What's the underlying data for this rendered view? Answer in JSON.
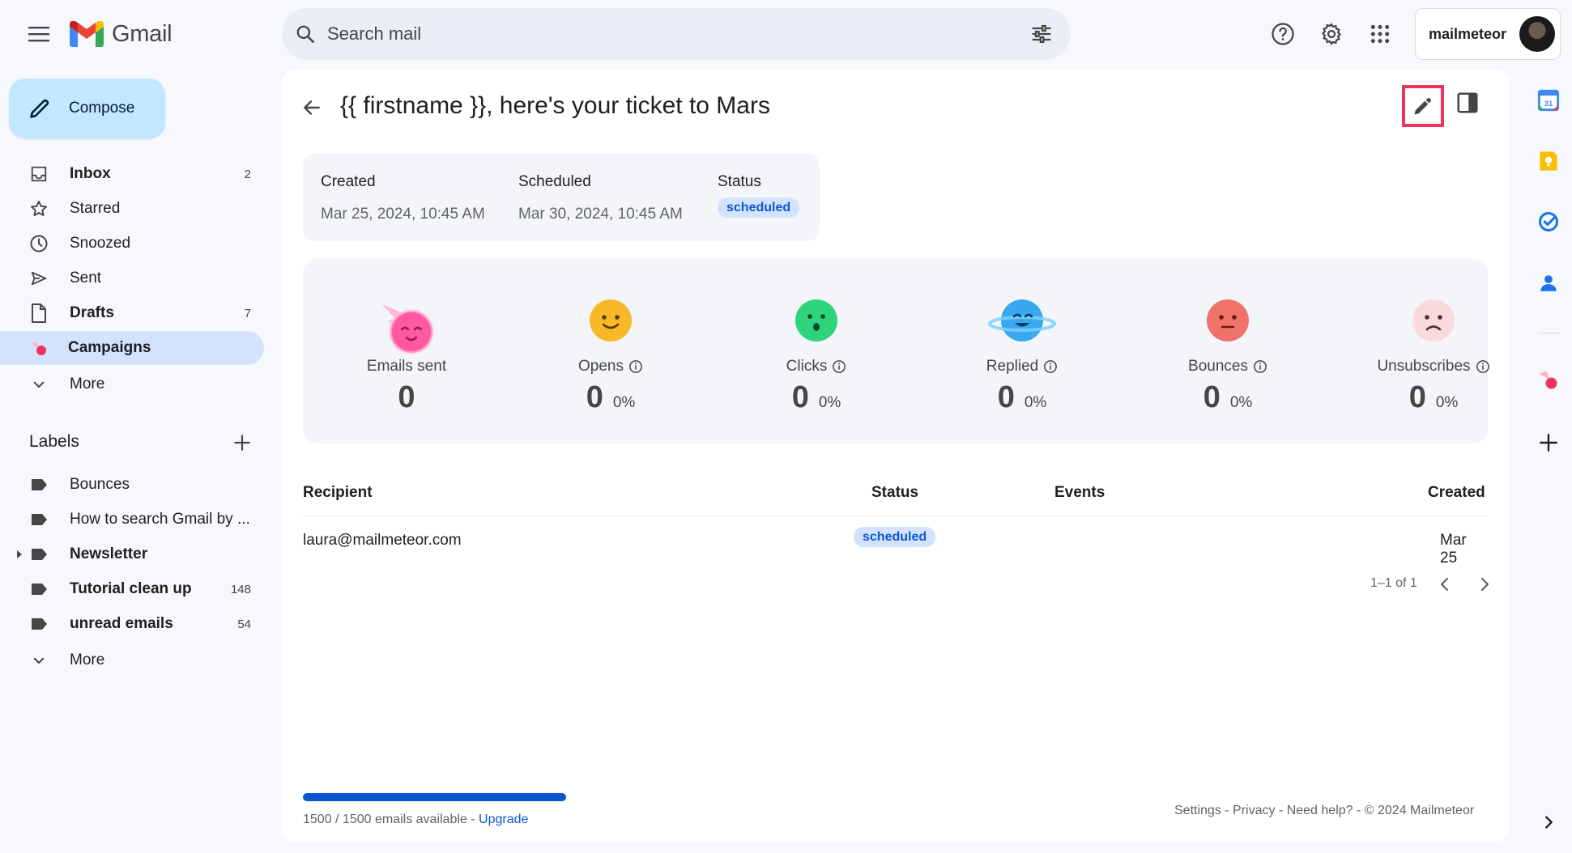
{
  "app": {
    "name": "Gmail"
  },
  "search": {
    "placeholder": "Search mail"
  },
  "account": {
    "name": "mailmeteor"
  },
  "compose": {
    "label": "Compose"
  },
  "nav": [
    {
      "label": "Inbox",
      "count": "2",
      "bold": true,
      "icon": "inbox-icon"
    },
    {
      "label": "Starred",
      "count": "",
      "bold": false,
      "icon": "star-icon"
    },
    {
      "label": "Snoozed",
      "count": "",
      "bold": false,
      "icon": "clock-icon"
    },
    {
      "label": "Sent",
      "count": "",
      "bold": false,
      "icon": "send-icon"
    },
    {
      "label": "Drafts",
      "count": "7",
      "bold": true,
      "icon": "draft-icon"
    },
    {
      "label": "Campaigns",
      "count": "",
      "bold": true,
      "icon": "mailmeteor-icon",
      "active": true
    },
    {
      "label": "More",
      "count": "",
      "bold": false,
      "icon": "chevron-down-icon"
    }
  ],
  "labels": {
    "title": "Labels",
    "items": [
      {
        "label": "Bounces",
        "count": "",
        "bold": false
      },
      {
        "label": "How to search Gmail by ...",
        "count": "",
        "bold": false
      },
      {
        "label": "Newsletter",
        "count": "",
        "bold": true
      },
      {
        "label": "Tutorial clean up",
        "count": "148",
        "bold": true
      },
      {
        "label": "unread emails",
        "count": "54",
        "bold": true
      }
    ],
    "more": "More"
  },
  "campaign": {
    "title": "{{ firstname }}, here's your ticket to Mars",
    "created_label": "Created",
    "created_value": "Mar 25, 2024, 10:45 AM",
    "scheduled_label": "Scheduled",
    "scheduled_value": "Mar 30, 2024, 10:45 AM",
    "status_label": "Status",
    "status_value": "scheduled"
  },
  "stats": [
    {
      "label": "Emails sent",
      "value": "0",
      "pct": "",
      "info": false,
      "color": "#ff5aa0"
    },
    {
      "label": "Opens",
      "value": "0",
      "pct": "0%",
      "info": true,
      "color": "#f7b928"
    },
    {
      "label": "Clicks",
      "value": "0",
      "pct": "0%",
      "info": true,
      "color": "#2ed47a"
    },
    {
      "label": "Replied",
      "value": "0",
      "pct": "0%",
      "info": true,
      "color": "#38a8f0"
    },
    {
      "label": "Bounces",
      "value": "0",
      "pct": "0%",
      "info": true,
      "color": "#f0736b"
    },
    {
      "label": "Unsubscribes",
      "value": "0",
      "pct": "0%",
      "info": true,
      "color": "#f6d2d6"
    }
  ],
  "table": {
    "headers": {
      "recipient": "Recipient",
      "status": "Status",
      "events": "Events",
      "created": "Created"
    },
    "rows": [
      {
        "recipient": "laura@mailmeteor.com",
        "status": "scheduled",
        "events": "",
        "created": "Mar 25"
      }
    ],
    "pagination": "1–1 of 1"
  },
  "footer": {
    "quota": "1500 / 1500 emails available - ",
    "quota_fraction": 1.0,
    "upgrade": "Upgrade",
    "links": "Settings - Privacy - Need help? - © 2024 Mailmeteor"
  },
  "colors": {
    "accent": "#0b57d0",
    "compose_bg": "#c2e7ff",
    "active_nav": "#d3e3fd",
    "highlight": "#f0325f"
  }
}
